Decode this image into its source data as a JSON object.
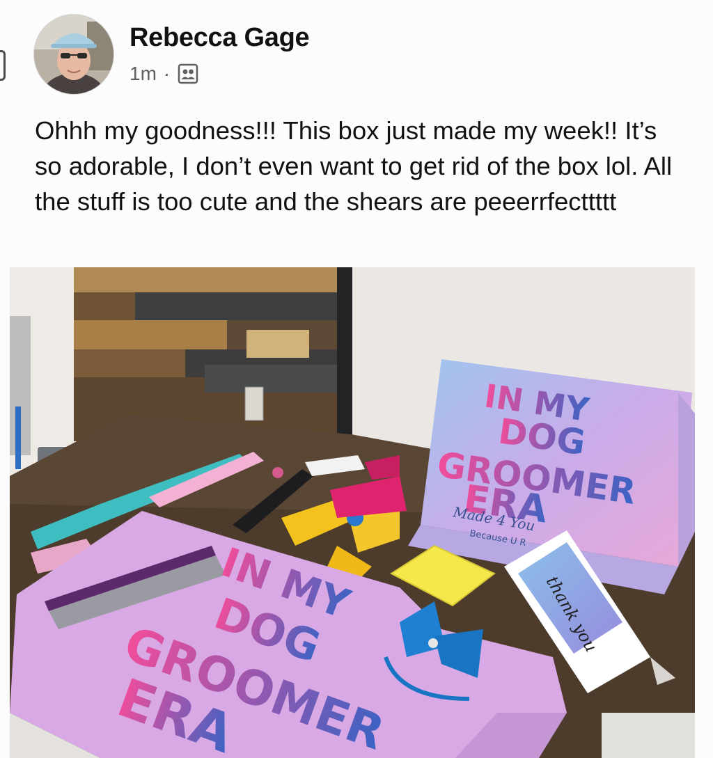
{
  "post": {
    "author_name": "Rebecca Gage",
    "timestamp": "1m",
    "separator": "·",
    "audience_icon": "friends-icon",
    "text": "Ohhh my goodness!!! This box just made my week!! It’s so adorable, I don’t even want to get rid of the box lol. All the stuff is too cute and the shears are peeerrfecttttt"
  },
  "photo": {
    "box_lines": [
      "IN MY",
      "DOG",
      "GROOMER",
      "ERA"
    ],
    "box_tagline": "Made 4 You",
    "box_subtag": "Because U R",
    "shirt_lines": [
      "IN MY",
      "DOG",
      "GROOMER",
      "ERA"
    ],
    "card_text": "thank you"
  },
  "colors": {
    "text_primary": "#111111",
    "text_secondary": "#5e5e5e",
    "brand_pink": "#f0509c",
    "brand_blue": "#3a63c4",
    "shirt_lavender": "#d8a9e4",
    "box_lavender": "#cfa9e2"
  }
}
